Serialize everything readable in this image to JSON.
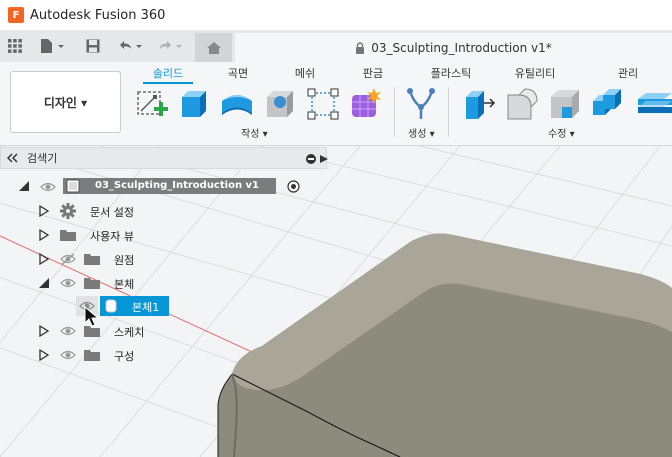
{
  "app": {
    "title": "Autodesk Fusion 360",
    "logo_letter": "F"
  },
  "document_tab": {
    "title": "03_Sculpting_Introduction v1*"
  },
  "workspace": {
    "label": "디자인 ▾"
  },
  "ribbon_tabs": [
    "솔리드",
    "곡면",
    "메쉬",
    "판금",
    "플라스틱",
    "유틸리티",
    "관리"
  ],
  "ribbon_active_tab": "솔리드",
  "tool_groups": {
    "create": "작성 ▾",
    "generate": "생성 ▾",
    "modify": "수정 ▾"
  },
  "browser": {
    "title": "검색기",
    "root": {
      "label": "03_Sculpting_Introduction v1"
    },
    "items": [
      {
        "label": "문서 설정"
      },
      {
        "label": "사용자 뷰"
      },
      {
        "label": "원점"
      },
      {
        "label": "본체"
      },
      {
        "label": "본체1"
      },
      {
        "label": "스케치"
      },
      {
        "label": "구성"
      }
    ]
  },
  "colors": {
    "accent": "#0696d7",
    "logo": "#f26522",
    "root_bar": "#7b7c7e",
    "model": "#8d8a7e"
  }
}
